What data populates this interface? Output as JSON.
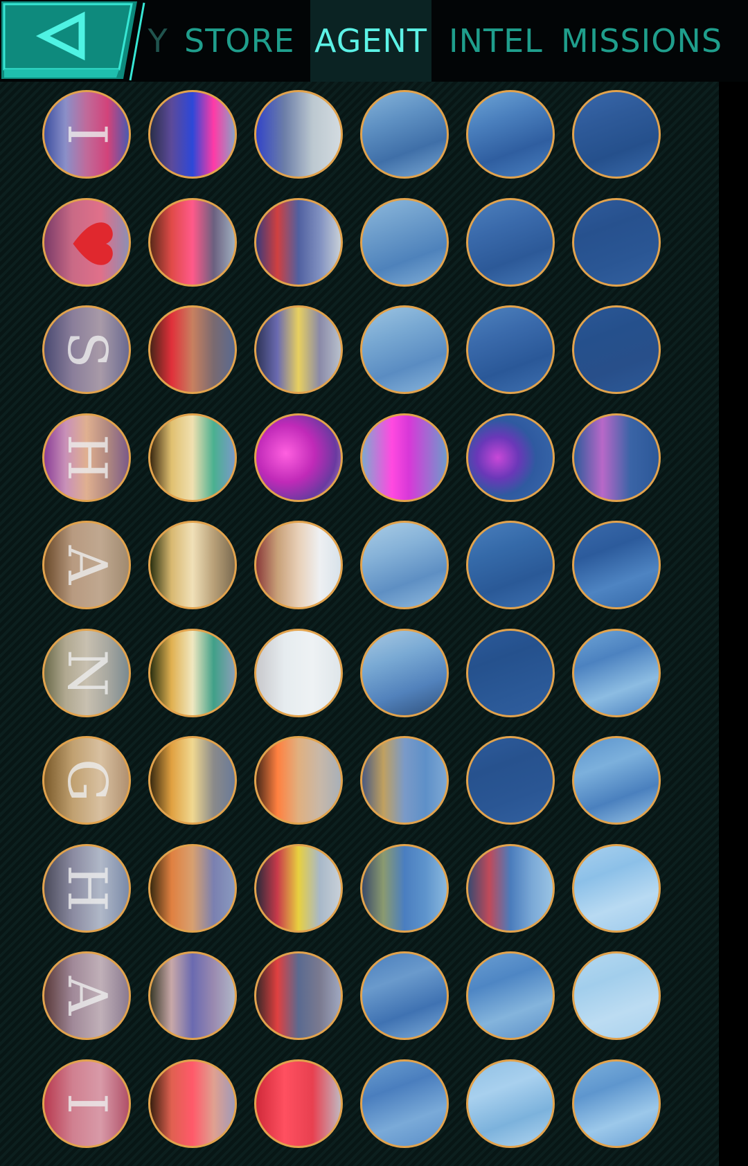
{
  "nav": {
    "back_icon": "back-triangle-icon",
    "tabs": [
      {
        "label": "Y",
        "state": "partial"
      },
      {
        "label": "STORE",
        "state": "normal"
      },
      {
        "label": "AGENT",
        "state": "active"
      },
      {
        "label": "INTEL",
        "state": "normal"
      },
      {
        "label": "MISSIONS",
        "state": "normal"
      }
    ]
  },
  "colors": {
    "accent": "#5cf2e6",
    "tab_text": "#1f9e8c",
    "medal_border": "#e2a34d"
  },
  "medals": [
    [
      {
        "letter": "I",
        "bg": "linear-gradient(90deg,#3d4fa0,#8a8fc8,#c06a9a,#d2437a,#4a5ab0)"
      },
      {
        "bg": "linear-gradient(90deg,#2a2f4a,#5c4a9a,#2d48d8,#ff3aa6,#8aa2c6)"
      },
      {
        "bg": "linear-gradient(90deg,#3244c8,#6c7ea8,#bcc8d0,#d3dbe0)"
      },
      {
        "bg": "linear-gradient(160deg,#86b4da,#5f91c3,#3f6fa8,#7aa8d4)"
      },
      {
        "bg": "linear-gradient(160deg,#6da4d6,#4a7fbd,#2f5ea0,#4a80c0)"
      },
      {
        "bg": "linear-gradient(160deg,#3968ab,#2e5a99,#25508c,#3a6aaa)"
      }
    ],
    [
      {
        "letter": "",
        "heart": true,
        "bg": "linear-gradient(90deg,#7a3b68,#c96a86,#e0708a,#8d8fb3)"
      },
      {
        "bg": "linear-gradient(90deg,#5c2a1a,#e04a48,#ff5a8a,#6b6080,#a0b0c0)"
      },
      {
        "bg": "linear-gradient(90deg,#3a3a7a,#d04040,#5060a0,#8090c0,#c8d0d8)"
      },
      {
        "bg": "linear-gradient(160deg,#8cb8dc,#6d9dcb,#4e82bb,#82afd8)"
      },
      {
        "bg": "linear-gradient(160deg,#4d80bd,#3a6aab,#2c5998,#4678b6)"
      },
      {
        "bg": "linear-gradient(160deg,#2f5b9b,#27518e,#2a5694,#33609f)"
      }
    ],
    [
      {
        "letter": "S",
        "bg": "linear-gradient(90deg,#4a4a72,#8a7e9a,#a89aa8,#6a6a90)"
      },
      {
        "bg": "linear-gradient(90deg,#4a2418,#e0303a,#c88060,#7a6a70,#5a6a90)"
      },
      {
        "bg": "linear-gradient(90deg,#2e3458,#6a6ab0,#e8d060,#8a8aa8,#b8c0cc)"
      },
      {
        "bg": "linear-gradient(160deg,#9cc4e2,#78a8d2,#5a8cc2,#8ab6dc)"
      },
      {
        "bg": "linear-gradient(160deg,#4e82be,#3a6aab,#2a5898,#3f70b0)"
      },
      {
        "bg": "linear-gradient(160deg,#2b5796,#25508c,#284f8a,#2d5a98)"
      }
    ],
    [
      {
        "letter": "H",
        "bg": "linear-gradient(90deg,#8a3e96,#c890b8,#e0b090,#b08880,#7a5a88)"
      },
      {
        "bg": "linear-gradient(90deg,#3a2810,#e0c070,#f0e0b0,#4ab090,#7a9ac8)"
      },
      {
        "bg": "radial-gradient(circle at 35% 45%,#ff60e0,#c02ab8 40%,#6a3aa0 70%,#c8a8c8)"
      },
      {
        "bg": "linear-gradient(90deg,#7fa8d0,#ff4ae0 35%,#d838d8 55%,#6f9acc)"
      },
      {
        "bg": "radial-gradient(circle at 35% 50%,#c848d8,#6a38b8 30%,#2f5aa0 55%,#3a6aab)"
      },
      {
        "bg": "linear-gradient(90deg,#2f5b9b,#b868c8,#3a64a6,#2c5898)"
      }
    ],
    [
      {
        "letter": "A",
        "bg": "linear-gradient(90deg,#6a4a2a,#b89a80,#c0a890,#a08a70)"
      },
      {
        "bg": "linear-gradient(90deg,#2a3010,#d8b870,#f0e0b8,#b8a078,#7a6a50)"
      },
      {
        "bg": "linear-gradient(90deg,#8a3a3a,#c8a078,#e8d0b8,#eef0f2,#d8e2ea)"
      },
      {
        "bg": "linear-gradient(160deg,#aacde6,#86b2d8,#5e8fc3,#92bce0)"
      },
      {
        "bg": "linear-gradient(160deg,#4a7ebc,#356aa9,#2a5997,#3d70b0)"
      },
      {
        "bg": "linear-gradient(160deg,#3a6aab,#2c5b9c,#4e84c2,#3468a8)"
      }
    ],
    [
      {
        "letter": "N",
        "bg": "linear-gradient(90deg,#6a6a4a,#b0a890,#c8c0b0,#a8a8a0,#7a8a90)"
      },
      {
        "bg": "linear-gradient(90deg,#2a3010,#e0b050,#f0e8c0,#40a088,#8aa0b8)"
      },
      {
        "bg": "linear-gradient(90deg,#c8c8cc,#e6ecef,#eef2f4,#dfe6ea)"
      },
      {
        "bg": "linear-gradient(160deg,#a8c8e2,#7aaad4,#5282bc,#2e4f7a)"
      },
      {
        "bg": "linear-gradient(160deg,#2c5a9a,#25518d,#2a5896,#305e9e)"
      },
      {
        "bg": "linear-gradient(160deg,#6ea4d6,#4c82c0,#8cbce2,#4a80be)"
      }
    ],
    [
      {
        "letter": "G",
        "bg": "linear-gradient(90deg,#7a5a2a,#c0a070,#d8c0a0,#b09070)"
      },
      {
        "bg": "linear-gradient(90deg,#3a2a10,#e0a040,#f0d890,#8a8a8a,#6a7a98)"
      },
      {
        "bg": "linear-gradient(90deg,#4a2818,#ff8040,#e0b080,#c8b8a8,#a8b0b8)"
      },
      {
        "bg": "linear-gradient(90deg,#4a5a80,#c0a060,#7a9ac8,#5e90c8,#7ea8d4)"
      },
      {
        "bg": "linear-gradient(160deg,#2e5b9b,#27528e,#2a5694,#32609f)"
      },
      {
        "bg": "linear-gradient(160deg,#5c94cc,#7cb0dc,#4a80be,#98c4e6)"
      }
    ],
    [
      {
        "letter": "H",
        "bg": "linear-gradient(90deg,#4a4a5a,#8a8aa0,#b0b8c8,#7a8aa8)"
      },
      {
        "bg": "linear-gradient(90deg,#3a2a10,#e08040,#d8a070,#7a80b0,#8a9ac0)"
      },
      {
        "bg": "linear-gradient(90deg,#2a2a3a,#c83a4a,#e8d040,#a8b8c8,#c8d0d8)"
      },
      {
        "bg": "linear-gradient(90deg,#3a4a68,#8a9a70,#4a7ec0,#5e94cc,#8ab8de)"
      },
      {
        "bg": "linear-gradient(90deg,#3a4a70,#c04a5a,#4a7cbc,#7aa8d6,#9ac4e4)"
      },
      {
        "bg": "linear-gradient(160deg,#a8d0ee,#8cc0e8,#b8daf2,#9ecaec)"
      }
    ],
    [
      {
        "letter": "A",
        "bg": "linear-gradient(90deg,#5a3a3a,#a08898,#c0b0b8,#8a7a90)"
      },
      {
        "bg": "linear-gradient(90deg,#3a3a2a,#c8a8a8,#6a6ab0,#9a8ab0,#b0b8c8)"
      },
      {
        "bg": "linear-gradient(90deg,#3a2828,#e04040,#5a6a90,#7a7a90,#a0a8c0)"
      },
      {
        "bg": "linear-gradient(160deg,#4a7ebc,#6a9acc,#3f72b2,#7eacd8)"
      },
      {
        "bg": "linear-gradient(160deg,#6a9ed2,#4e86c4,#84b4dc,#5c90c8)"
      },
      {
        "bg": "linear-gradient(160deg,#b4d8f0,#a2ceec,#bcdcf2,#aad2ee)"
      }
    ],
    [
      {
        "letter": "I",
        "bg": "linear-gradient(90deg,#b83a50,#d08090,#d89aa8,#b05068)"
      },
      {
        "bg": "linear-gradient(90deg,#3a2010,#e06050,#ff5a6a,#e0a090,#a09ab8)"
      },
      {
        "bg": "linear-gradient(90deg,#d02a3a,#ff5060,#e84050,#c0b8c0)"
      },
      {
        "bg": "linear-gradient(160deg,#6a9ed0,#4a7ebe,#7aaad8,#5a8ec8)"
      },
      {
        "bg": "linear-gradient(160deg,#90c0e4,#a8d0ee,#7cb2dc,#b2d6f0)"
      },
      {
        "bg": "linear-gradient(160deg,#7cb0dc,#5e96ce,#9cc8ea,#6aa0d4)"
      }
    ]
  ]
}
